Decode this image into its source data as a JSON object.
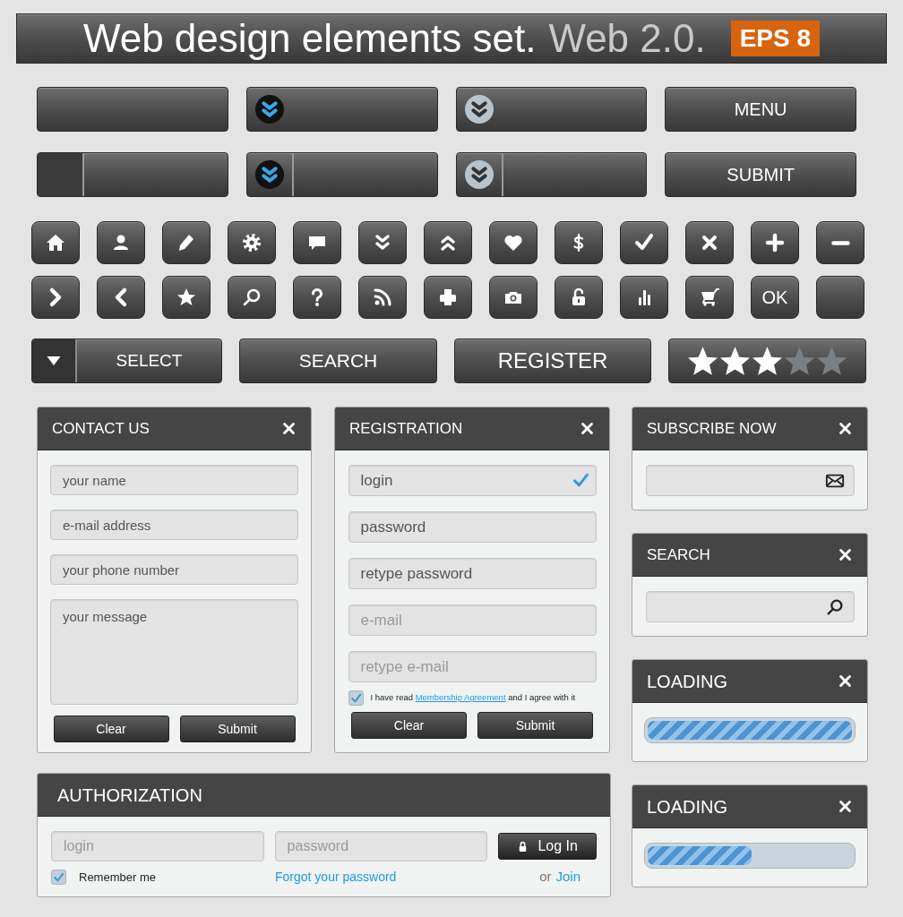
{
  "title": {
    "text": "Web design elements set.",
    "subtitle": "Web 2.0.",
    "badge": "EPS 8"
  },
  "bar_rows": [
    [
      {
        "kind": "plain",
        "split": false
      },
      {
        "kind": "dark-toggle",
        "split": false
      },
      {
        "kind": "light-toggle",
        "split": false
      },
      {
        "kind": "label",
        "label": "MENU"
      }
    ],
    [
      {
        "kind": "plain",
        "split": true
      },
      {
        "kind": "dark-toggle",
        "split": true
      },
      {
        "kind": "light-toggle",
        "split": true
      },
      {
        "kind": "label",
        "label": "SUBMIT"
      }
    ]
  ],
  "icon_buttons": [
    {
      "kind": "home"
    },
    {
      "kind": "user"
    },
    {
      "kind": "pencil"
    },
    {
      "kind": "gear"
    },
    {
      "kind": "chat"
    },
    {
      "kind": "chevrons-down"
    },
    {
      "kind": "chevrons-up"
    },
    {
      "kind": "heart"
    },
    {
      "kind": "dollar"
    },
    {
      "kind": "check"
    },
    {
      "kind": "cross"
    },
    {
      "kind": "plus"
    },
    {
      "kind": "minus"
    },
    {
      "kind": "chevron-right"
    },
    {
      "kind": "chevron-left"
    },
    {
      "kind": "star"
    },
    {
      "kind": "search"
    },
    {
      "kind": "question"
    },
    {
      "kind": "rss"
    },
    {
      "kind": "printer"
    },
    {
      "kind": "camera"
    },
    {
      "kind": "lock"
    },
    {
      "kind": "bars"
    },
    {
      "kind": "cart"
    },
    {
      "kind": "text",
      "label": "OK"
    },
    {
      "kind": "blank"
    }
  ],
  "controls": {
    "select": "SELECT",
    "search": "SEARCH",
    "register": "REGISTER",
    "stars": 3
  },
  "contact": {
    "title": "CONTACT US",
    "fields": [
      {
        "placeholder": "your name"
      },
      {
        "placeholder": "e-mail address"
      },
      {
        "placeholder": "your phone number"
      }
    ],
    "message": {
      "placeholder": "your message"
    },
    "buttons": [
      "Clear",
      "Submit"
    ]
  },
  "registration": {
    "title": "REGISTRATION",
    "fields": [
      {
        "value": "login",
        "valid": true
      },
      {
        "value": "password",
        "valid": false
      },
      {
        "value": "retype password",
        "valid": false
      },
      {
        "placeholder": "e-mail",
        "valid": false
      },
      {
        "placeholder": "retype e-mail",
        "valid": false
      }
    ],
    "agreement": {
      "checked": true,
      "before": "I have read",
      "link": "Membership Agreement",
      "after": "and I agree with it"
    },
    "buttons": [
      "Clear",
      "Submit"
    ]
  },
  "subscribe": {
    "title": "SUBSCRIBE NOW"
  },
  "search_panel": {
    "title": "SEARCH"
  },
  "loading": [
    {
      "title": "LOADING",
      "level": 1.0
    },
    {
      "title": "LOADING",
      "level": 0.51
    }
  ],
  "authorization": {
    "title": "AUTHORIZATION",
    "login": {
      "placeholder": "login"
    },
    "password": {
      "placeholder": "password"
    },
    "button": "Log In",
    "remember": {
      "label": "Remember me",
      "checked": true
    },
    "forgot": "Forgot your password",
    "or": "or",
    "join": "Join"
  }
}
